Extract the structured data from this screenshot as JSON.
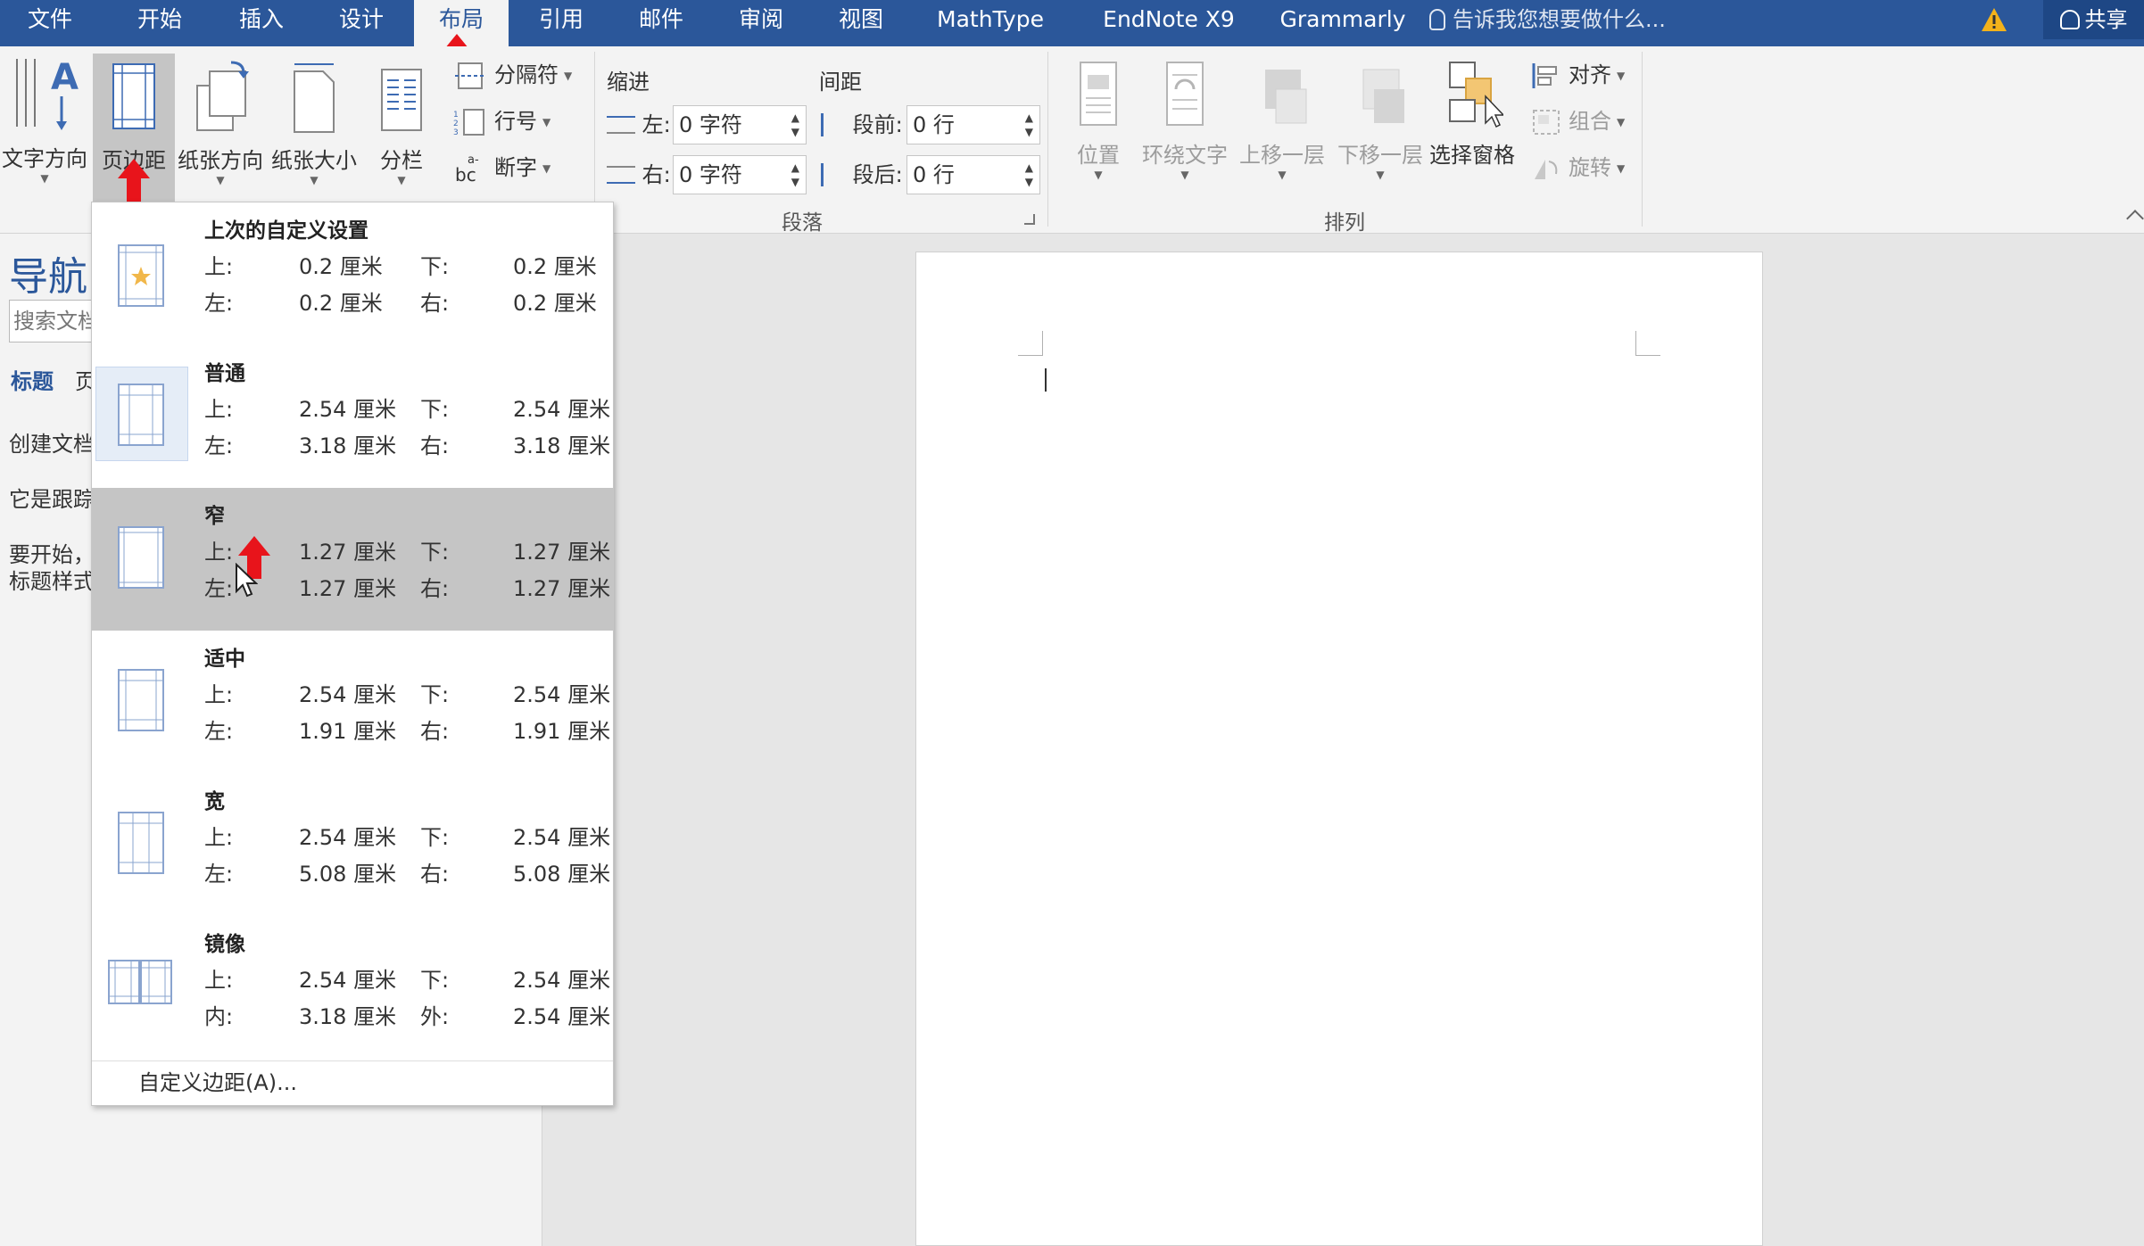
{
  "tabs": [
    "文件",
    "开始",
    "插入",
    "设计",
    "布局",
    "引用",
    "邮件",
    "审阅",
    "视图",
    "MathType",
    "EndNote X9",
    "Grammarly"
  ],
  "active_tab": "布局",
  "tell_me": "告诉我您想要做什么...",
  "share": "共享",
  "ribbon": {
    "text_direction": "文字方向",
    "margins": "页边距",
    "orientation": "纸张方向",
    "size": "纸张大小",
    "columns": "分栏",
    "breaks": "分隔符",
    "line_numbers": "行号",
    "hyphenation": "断字",
    "hyphen_icon_text": "bc",
    "hyphen_icon_sup": "a-",
    "indent_title": "缩进",
    "indent_left_label": "左:",
    "indent_left_value": "0 字符",
    "indent_right_label": "右:",
    "indent_right_value": "0 字符",
    "spacing_title": "间距",
    "spacing_before_label": "段前:",
    "spacing_before_value": "0 行",
    "spacing_after_label": "段后:",
    "spacing_after_value": "0 行",
    "paragraph_group": "段落",
    "position": "位置",
    "wrap_text": "环绕文字",
    "bring_forward": "上移一层",
    "send_backward": "下移一层",
    "selection_pane": "选择窗格",
    "align": "对齐",
    "group": "组合",
    "rotate": "旋转",
    "arrange_group": "排列"
  },
  "nav": {
    "title": "导航",
    "search_placeholder": "搜索文档",
    "tab_headings": "标题",
    "tab_pages": "页",
    "line1": "创建文档",
    "line2": "它是跟踪",
    "line3": "要开始，",
    "line4": "标题样式"
  },
  "margins_menu": {
    "options": [
      {
        "name": "上次的自定义设置",
        "l1": "上:",
        "v1": "0.2 厘米",
        "l2": "下:",
        "v2": "0.2 厘米",
        "l3": "左:",
        "v3": "0.2 厘米",
        "l4": "右:",
        "v4": "0.2 厘米"
      },
      {
        "name": "普通",
        "l1": "上:",
        "v1": "2.54 厘米",
        "l2": "下:",
        "v2": "2.54 厘米",
        "l3": "左:",
        "v3": "3.18 厘米",
        "l4": "右:",
        "v4": "3.18 厘米"
      },
      {
        "name": "窄",
        "l1": "上:",
        "v1": "1.27 厘米",
        "l2": "下:",
        "v2": "1.27 厘米",
        "l3": "左:",
        "v3": "1.27 厘米",
        "l4": "右:",
        "v4": "1.27 厘米"
      },
      {
        "name": "适中",
        "l1": "上:",
        "v1": "2.54 厘米",
        "l2": "下:",
        "v2": "2.54 厘米",
        "l3": "左:",
        "v3": "1.91 厘米",
        "l4": "右:",
        "v4": "1.91 厘米"
      },
      {
        "name": "宽",
        "l1": "上:",
        "v1": "2.54 厘米",
        "l2": "下:",
        "v2": "2.54 厘米",
        "l3": "左:",
        "v3": "5.08 厘米",
        "l4": "右:",
        "v4": "5.08 厘米"
      },
      {
        "name": "镜像",
        "l1": "上:",
        "v1": "2.54 厘米",
        "l2": "下:",
        "v2": "2.54 厘米",
        "l3": "内:",
        "v3": "3.18 厘米",
        "l4": "外:",
        "v4": "2.54 厘米"
      }
    ],
    "custom": "自定义边距(A)..."
  },
  "colors": {
    "brand": "#2b579a",
    "hover": "#c5c5c5",
    "arrow": "#e8141b"
  }
}
